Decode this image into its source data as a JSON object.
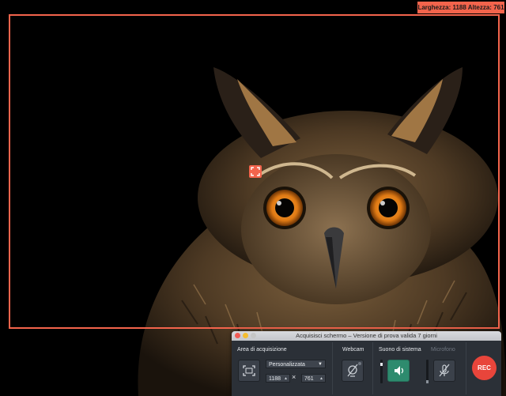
{
  "capture": {
    "dimensions_label": "Larghezza: 1188 Altezza: 761"
  },
  "panel": {
    "title": "Acquisisci schermo – Versione di prova valida 7 giorni",
    "area_label": "Area di acquisizione",
    "preset_value": "Personalizzata",
    "width_value": "1188",
    "times_symbol": "×",
    "height_value": "761",
    "webcam_label": "Webcam",
    "system_sound_label": "Suono di sistema",
    "microphone_label": "Microfono",
    "rec_label": "REC"
  },
  "colors": {
    "accent": "#f3644c",
    "panel_bg": "#2b3037",
    "sound_active": "#2e8b6e",
    "rec": "#e8453b"
  }
}
